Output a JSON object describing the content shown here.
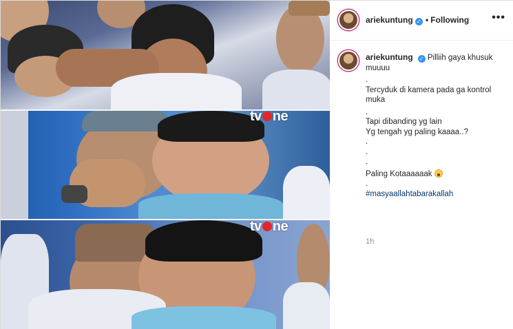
{
  "header": {
    "username": "ariekuntung",
    "verified_mark": "✓",
    "separator": "•",
    "follow_status": "Following",
    "more_label": "•••"
  },
  "caption": {
    "username": "ariekuntung",
    "verified_mark": "✓",
    "first_line": "Pilliih gaya khusuk muuuu",
    "lines": [
      ".",
      "Tercyduk di kamera pada ga kontrol muka",
      ".",
      "Tapi dibanding yg lain",
      "Yg tengah yg paling kaaaa..?",
      ".",
      ".",
      ".",
      "Paling Kotaaaaaak"
    ],
    "dot_after": ".",
    "hashtag": "#masyaallahtabarakallah",
    "time_ago": "1h"
  },
  "media": {
    "watermark_1": "tv",
    "watermark_1b": "ne",
    "watermark_2": "tv",
    "watermark_2b": "ne",
    "icons": [
      "avatar-icon",
      "verified-badge-icon",
      "more-options-icon",
      "scared-face-emoji-icon"
    ]
  }
}
